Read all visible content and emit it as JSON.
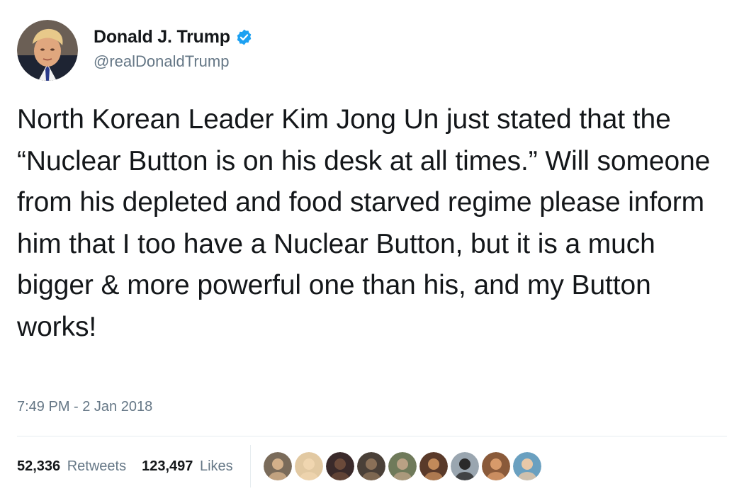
{
  "author": {
    "display_name": "Donald J. Trump",
    "handle": "@realDonaldTrump",
    "verified": true
  },
  "tweet": {
    "text": "North Korean Leader Kim Jong Un just stated that the “Nuclear Button is on his desk at all times.” Will someone from his depleted and food starved regime please inform him that I too have a Nuclear Button, but it is a much bigger & more powerful one than his, and my Button works!",
    "timestamp": "7:49 PM - 2 Jan 2018"
  },
  "stats": {
    "retweets_count": "52,336",
    "retweets_label": "Retweets",
    "likes_count": "123,497",
    "likes_label": "Likes"
  },
  "colors": {
    "text": "#14171a",
    "secondary": "#657786",
    "verified": "#1da1f2",
    "divider": "#e6ecf0"
  },
  "likers": [
    {
      "name": "liker-1",
      "bg": "#7a6b5a",
      "fg": "#d3b08a"
    },
    {
      "name": "liker-2",
      "bg": "#e2c9a2",
      "fg": "#f0d6b0"
    },
    {
      "name": "liker-3",
      "bg": "#3a2a2a",
      "fg": "#6b4a3a"
    },
    {
      "name": "liker-4",
      "bg": "#4a4038",
      "fg": "#8a7058"
    },
    {
      "name": "liker-5",
      "bg": "#6f7a5a",
      "fg": "#b9a184"
    },
    {
      "name": "liker-6",
      "bg": "#5a3a2a",
      "fg": "#c28a5a"
    },
    {
      "name": "liker-7",
      "bg": "#9aa6b0",
      "fg": "#2a2a2a"
    },
    {
      "name": "liker-8",
      "bg": "#8a5a3a",
      "fg": "#d89a6a"
    },
    {
      "name": "liker-9",
      "bg": "#6aa0c0",
      "fg": "#e8c8a8"
    }
  ]
}
